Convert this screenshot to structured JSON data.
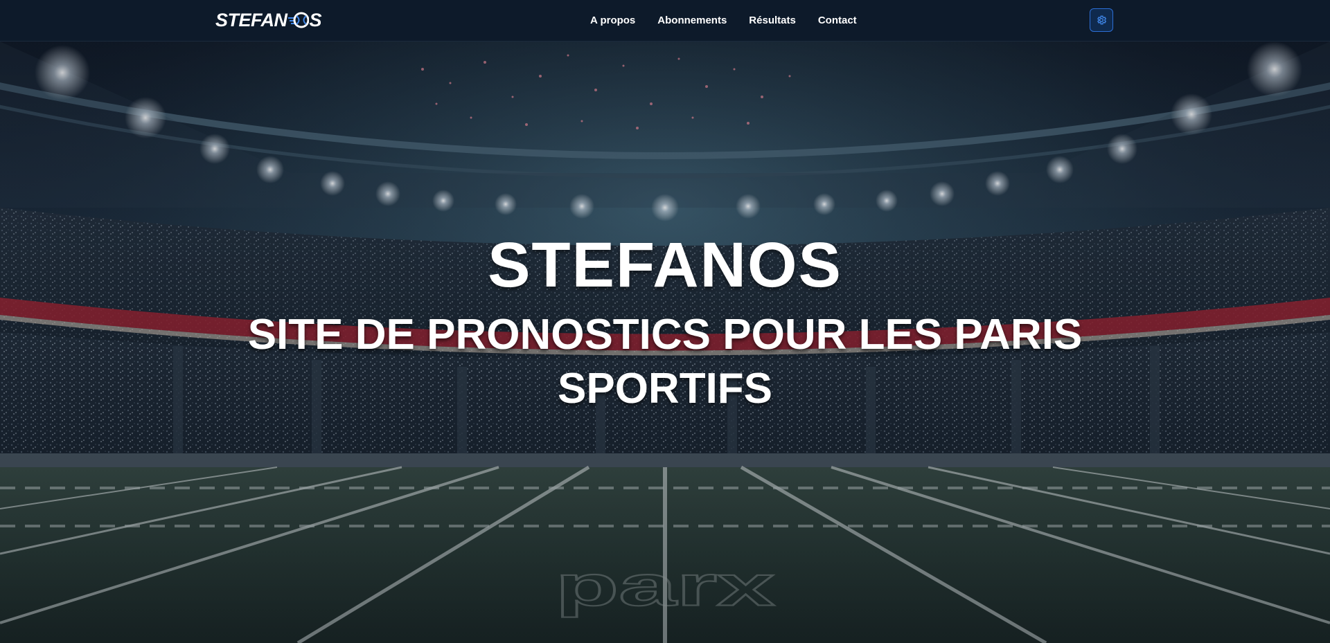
{
  "brand": {
    "part_a": "STEFAN",
    "part_b": "S",
    "ball_icon": "tennis-ball-icon"
  },
  "nav": {
    "items": [
      {
        "label": "A propos"
      },
      {
        "label": "Abonnements"
      },
      {
        "label": "Résultats"
      },
      {
        "label": "Contact"
      }
    ]
  },
  "settings": {
    "icon": "gear-icon"
  },
  "hero": {
    "title": "STEFANOS",
    "subtitle": "SITE DE PRONOSTICS POUR LES PARIS SPORTIFS",
    "background": "stadium-night-illustration"
  },
  "colors": {
    "navbar_bg": "#0d1a2a",
    "accent": "#2c6fd6",
    "text": "#ffffff"
  }
}
